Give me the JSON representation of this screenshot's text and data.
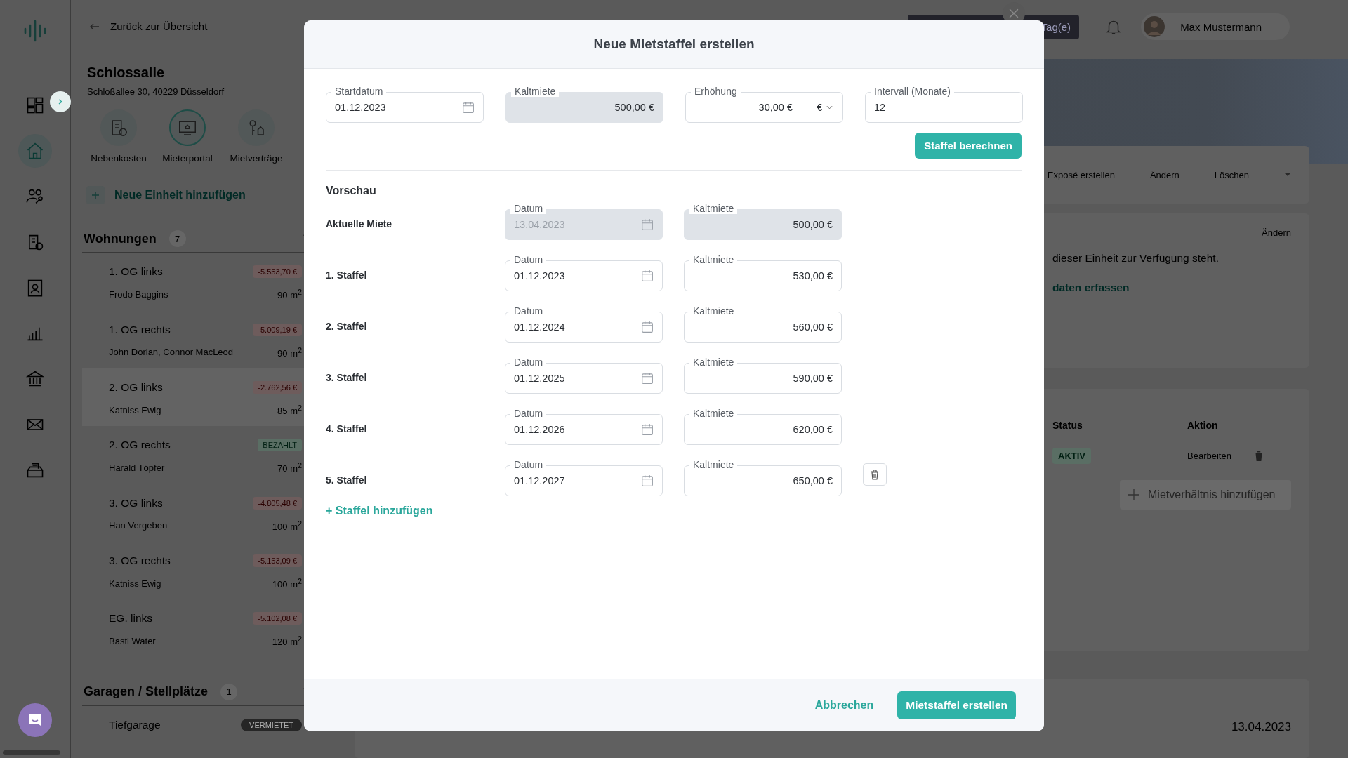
{
  "rail": {
    "items": [
      {
        "selected": false
      },
      {
        "selected": true
      },
      {
        "selected": false
      },
      {
        "selected": false
      },
      {
        "selected": false
      },
      {
        "selected": false
      },
      {
        "selected": false
      },
      {
        "selected": false
      },
      {
        "selected": false
      }
    ]
  },
  "sidebar": {
    "back_link": "Zurück zur Übersicht",
    "title": "Schlossalle",
    "address": "Schloßallee 30, 40229 Düsseldorf",
    "actions": [
      {
        "label": "Nebenkosten",
        "selected": false
      },
      {
        "label": "Mieterportal",
        "selected": true
      },
      {
        "label": "Mietverträge",
        "selected": false
      }
    ],
    "add_unit": "Neue Einheit hinzufügen",
    "sections": [
      {
        "title": "Wohnungen",
        "count": "7",
        "expanded": true,
        "units": [
          {
            "name": "1. OG links",
            "badge": "-5.553,70 €",
            "kind": "overdue",
            "tenant": "Frodo Baggins",
            "area": "90 m$^{2}$",
            "selected": false
          },
          {
            "name": "1. OG rechts",
            "badge": "-5.009,19 €",
            "kind": "overdue",
            "tenant": "John Dorian, Connor MacLeod",
            "area": "90 m$^{2}$",
            "selected": false
          },
          {
            "name": "2. OG links",
            "badge": "-2.762,56 €",
            "kind": "overdue",
            "tenant": "Katniss Ewig",
            "area": "85 m$^{2}$",
            "selected": true
          },
          {
            "name": "2. OG rechts",
            "badge": "BEZAHLT",
            "kind": "paid",
            "tenant": "Harald Töpfer",
            "area": "70 m$^{2}$",
            "selected": false
          },
          {
            "name": "3. OG links",
            "badge": "-4.805,48 €",
            "kind": "overdue",
            "tenant": "Han Vergeben",
            "area": "100 m$^{2}$",
            "selected": false
          },
          {
            "name": "3. OG rechts",
            "badge": "-5.153,09 €",
            "kind": "overdue",
            "tenant": "Katniss Ewig",
            "area": "100 m$^{2}$",
            "selected": false
          },
          {
            "name": "EG. links",
            "badge": "-5.102,08 €",
            "kind": "overdue",
            "tenant": "Basti Water",
            "area": "120 m$^{2}$",
            "selected": false
          }
        ]
      },
      {
        "title": "Garagen / Stellplätze",
        "count": "1",
        "expanded": true,
        "units": [
          {
            "name": "Tiefgarage",
            "badge": "VERMIETET",
            "kind": "rented",
            "selected": false
          }
        ]
      }
    ]
  },
  "topbar": {
    "trial_button": "Tag(e)",
    "user_name": "Max Mustermann"
  },
  "property": {
    "actions": [
      "Exposé erstellen",
      "Ändern",
      "Löschen"
    ],
    "info_edit": "Ändern",
    "info_text": "dieser Einheit zur Verfügung steht.",
    "info_link": "daten erfassen",
    "tenancy": {
      "columns": [
        "Status",
        "Aktion"
      ],
      "status": "AKTIV",
      "edit": "Bearbeiten",
      "add_button": "Mietverhältnis hinzufügen"
    },
    "date": "13.04.2023"
  },
  "modal": {
    "title": "Neue Mietstaffel erstellen",
    "fields": [
      {
        "kind": "date",
        "label": "Startdatum",
        "value": "01.12.2023",
        "disabled": false
      },
      {
        "kind": "money",
        "label": "Kaltmiete",
        "value": "500,00 €",
        "disabled": true
      },
      {
        "kind": "money_unit",
        "label": "Erhöhung",
        "value": "30,00 €",
        "unit": "€",
        "disabled": false
      },
      {
        "kind": "number",
        "label": "Intervall (Monate)",
        "value": "12",
        "disabled": false
      }
    ],
    "calc_button": "Staffel berechnen",
    "preview_title": "Vorschau",
    "rows": [
      {
        "label": "Aktuelle Miete",
        "date": {
          "label": "Datum",
          "value": "13.04.2023",
          "disabled": true
        },
        "rent": {
          "label": "Kaltmiete",
          "value": "500,00 €",
          "disabled": true
        },
        "deletable": false
      },
      {
        "label": "1. Staffel",
        "date": {
          "label": "Datum",
          "value": "01.12.2023",
          "disabled": false
        },
        "rent": {
          "label": "Kaltmiete",
          "value": "530,00 €",
          "disabled": false
        },
        "deletable": false
      },
      {
        "label": "2. Staffel",
        "date": {
          "label": "Datum",
          "value": "01.12.2024",
          "disabled": false
        },
        "rent": {
          "label": "Kaltmiete",
          "value": "560,00 €",
          "disabled": false
        },
        "deletable": false
      },
      {
        "label": "3. Staffel",
        "date": {
          "label": "Datum",
          "value": "01.12.2025",
          "disabled": false
        },
        "rent": {
          "label": "Kaltmiete",
          "value": "590,00 €",
          "disabled": false
        },
        "deletable": false
      },
      {
        "label": "4. Staffel",
        "date": {
          "label": "Datum",
          "value": "01.12.2026",
          "disabled": false
        },
        "rent": {
          "label": "Kaltmiete",
          "value": "620,00 €",
          "disabled": false
        },
        "deletable": false
      },
      {
        "label": "5. Staffel",
        "date": {
          "label": "Datum",
          "value": "01.12.2027",
          "disabled": false
        },
        "rent": {
          "label": "Kaltmiete",
          "value": "650,00 €",
          "disabled": false
        },
        "deletable": true
      }
    ],
    "add_link": "+ Staffel hinzufügen",
    "cancel": "Abbrechen",
    "submit": "Mietstaffel erstellen"
  }
}
